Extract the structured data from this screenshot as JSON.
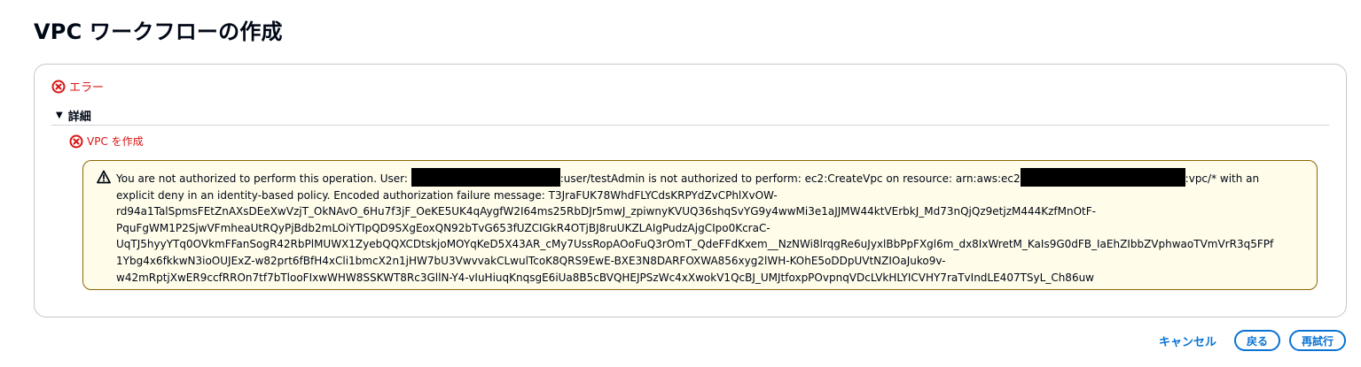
{
  "page": {
    "title": "VPC ワークフローの作成"
  },
  "error": {
    "label": "エラー",
    "details_label": "詳細",
    "sub_error_label": "VPC を作成",
    "message_lines": [
      {
        "pre": "You are not authorized to perform this operation. User: ",
        "mid": ":user/testAdmin is not authorized to perform: ec2:CreateVpc on resource: arn:aws:ec2",
        "post": ":vpc/* with an"
      },
      {
        "text": "explicit deny in an identity-based policy. Encoded authorization failure message: T3JraFUK78WhdFLYCdsKRPYdZvCPhlXvOW-"
      },
      {
        "text": "rd94a1TalSpmsFEtZnAXsDEeXwVzjT_OkNAvO_6Hu7f3jF_OeKE5UK4qAygfW2I64ms25RbDJr5mwJ_zpiwnyKVUQ36shqSvYG9y4wwMi3e1aJJMW44ktVErbkJ_Md73nQjQz9etjzM444KzfMnOtF-"
      },
      {
        "text": "PquFgWM1P2SjwVFmheaUtRQyPjBdb2mLOiYTIpQD9SXgEoxQN92bTvG653fUZCIGkR4OTjBJ8ruUKZLAIgPudzAjgCIpo0KcraC-"
      },
      {
        "text": "UqTJ5hyyYTq0OVkmFFanSogR42RbPlMUWX1ZyebQQXCDtskjoMOYqKeD5X43AR_cMy7UssRopAOoFuQ3rOmT_QdeFFdKxem__NzNWi8lrqgRe6uJyxlBbPpFXgl6m_dx8IxWretM_KaIs9G0dFB_IaEhZIbbZVphwaoTVmVrR3q5FPf"
      },
      {
        "text": "1Ybg4x6fkkwN3ioOUJExZ-w82prt6fBfH4xCli1bmcX2n1jHW7bU3VwvvakCLwulTcoK8QRS9EwE-BXE3N8DARFOXWA856xyg2lWH-KOhE5oDDpUVtNZIOaJuko9v-"
      },
      {
        "text": "w42mRptjXwER9ccfRROn7tf7bTlooFIxwWHW8SSKWT8Rc3GllN-Y4-vIuHiuqKnqsgE6iUa8B5cBVQHEJPSzWc4xXwokV1QcBJ_UMJtfoxpPOvpnqVDcLVkHLYICVHY7raTvIndLE407TSyL_Ch86uw"
      }
    ]
  },
  "footer": {
    "cancel_label": "キャンセル",
    "back_label": "戻る",
    "retry_label": "再試行"
  },
  "colors": {
    "error": "#d91515",
    "link": "#0972d3",
    "warning_bg": "#fffce9",
    "warning_border": "#8d6605"
  }
}
